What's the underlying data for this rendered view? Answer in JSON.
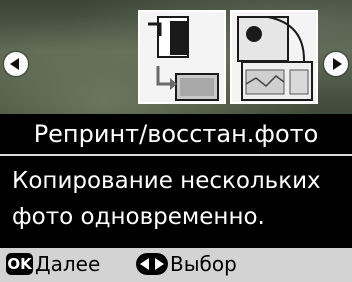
{
  "menu": {
    "title": "Репринт/восстан.фото",
    "description_lines": [
      "Копирование нескольких",
      "фото одновременно."
    ],
    "icons": {
      "prev": "arrow-left-icon",
      "next": "arrow-right-icon",
      "selected_mode": "reprint-photo-icon",
      "other_mode": "restore-photo-icon"
    }
  },
  "footer": {
    "ok_key": "OK",
    "ok_action": "Далее",
    "arrows_icon": "left-right-arrows-icon",
    "arrows_action": "Выбор"
  },
  "colors": {
    "background": "#000000",
    "text": "#ffffff",
    "footer_bg": "#d3d3d3",
    "tile_bg": "#f4f4f4"
  }
}
